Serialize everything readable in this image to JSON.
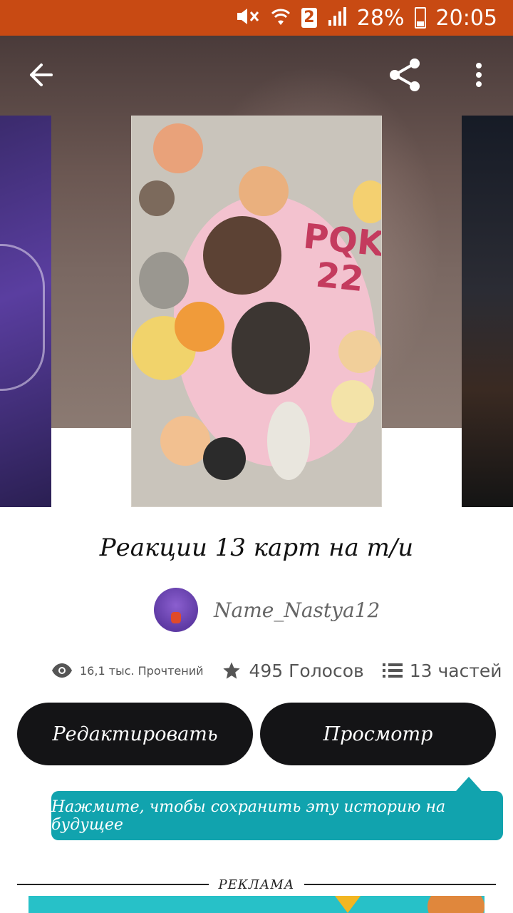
{
  "status_bar": {
    "sim": "2",
    "battery": "28%",
    "time": "20:05"
  },
  "cover": {
    "text": "PQK\n22"
  },
  "story": {
    "title": "Реакции 13 карт на т/и",
    "author": "Name_Nastya12"
  },
  "stats": {
    "reads": "16,1 тыс. Прочтений",
    "votes": "495 Голосов",
    "parts": "13 частей"
  },
  "actions": {
    "edit_label": "Редактировать",
    "view_label": "Просмотр"
  },
  "tooltip": {
    "text": "Нажмите, чтобы сохранить эту историю на будущее"
  },
  "ad": {
    "label": "РЕКЛАМА"
  },
  "colors": {
    "status_bar": "#c84a13",
    "button": "#141416",
    "tooltip": "#11a3ae"
  },
  "icons": {
    "back": "arrow-left-icon",
    "share": "share-icon",
    "more": "more-vertical-icon",
    "reads": "eye-icon",
    "votes": "star-icon",
    "parts": "list-icon"
  }
}
